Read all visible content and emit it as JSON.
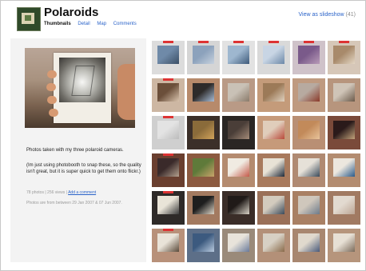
{
  "header": {
    "title": "Polaroids",
    "nav": [
      "Thumbnails",
      "Detail",
      "Map",
      "Comments"
    ],
    "nav_active": 0,
    "slideshow_label": "View as slideshow",
    "slideshow_count": "(41)"
  },
  "sidebar": {
    "description": "Photos taken with my three polaroid cameras.",
    "description2": "(Im just using photobooth to snap these, so the quality isn't great, but it is super quick to get them onto flickr.)",
    "meta_prefix": "78 photos | 256 views |",
    "comment_link": "Add a comment",
    "meta_dates": "Photos are from between 29 Jan 2007 & 07 Jun 2007."
  },
  "thumbnails": [
    {
      "bg": "#dcdcdc",
      "in": "#6f8aa8",
      "ac": "#3b4f66"
    },
    {
      "bg": "#d5d5d5",
      "in": "#8ca2bc",
      "ac": "#c7d2de"
    },
    {
      "bg": "#e2e2e2",
      "in": "#9eb7cf",
      "ac": "#3e5a7a"
    },
    {
      "bg": "#d9d9d9",
      "in": "#c8d5e4",
      "ac": "#6c88a8"
    },
    {
      "bg": "#cfc2c9",
      "in": "#7a5a8a",
      "ac": "#b89ab8"
    },
    {
      "bg": "#d6c7b8",
      "in": "#a88a6b",
      "ac": "#e3d6c4"
    },
    {
      "bg": "#cdb7a3",
      "in": "#6b4f3a",
      "ac": "#d8c3ad"
    },
    {
      "bg": "#b78a6b",
      "in": "#2e2b2a",
      "ac": "#a9bfd9"
    },
    {
      "bg": "#b99a86",
      "in": "#c9c1b6",
      "ac": "#8a7a6a"
    },
    {
      "bg": "#c49b7a",
      "in": "#9c7a58",
      "ac": "#e0d2c0"
    },
    {
      "bg": "#bf9a80",
      "in": "#b7aaa0",
      "ac": "#8a3a2a"
    },
    {
      "bg": "#b7957d",
      "in": "#cfc4b7",
      "ac": "#6b5a4a"
    },
    {
      "bg": "#cfcfcf",
      "in": "#e3e3e3",
      "ac": "#bcbcbc"
    },
    {
      "bg": "#3b2f29",
      "in": "#8a6b3a",
      "ac": "#d1a35a"
    },
    {
      "bg": "#2a2624",
      "in": "#4a3e38",
      "ac": "#a38a78"
    },
    {
      "bg": "#c69a7a",
      "in": "#e0cdbb",
      "ac": "#b94a3a"
    },
    {
      "bg": "#b98f74",
      "in": "#c28a5a",
      "ac": "#e8c39a"
    },
    {
      "bg": "#7a4a3a",
      "in": "#2a1a1a",
      "ac": "#c2a27a"
    },
    {
      "bg": "#6a3f2f",
      "in": "#3a2a2a",
      "ac": "#b3a08e"
    },
    {
      "bg": "#8c5a40",
      "in": "#5f7a3a",
      "ac": "#c9a46a"
    },
    {
      "bg": "#b48b6f",
      "in": "#f0ebe2",
      "ac": "#c45a4a"
    },
    {
      "bg": "#a87a5d",
      "in": "#e8e2d6",
      "ac": "#1f2a3a"
    },
    {
      "bg": "#b08a72",
      "in": "#e6e1d8",
      "ac": "#3a4a5a"
    },
    {
      "bg": "#b38c70",
      "in": "#ece7de",
      "ac": "#2a5a8a"
    },
    {
      "bg": "#2e2a28",
      "in": "#e9e4d8",
      "ac": "#3a3a3a"
    },
    {
      "bg": "#a37a60",
      "in": "#1e1e1e",
      "ac": "#e0d8ca"
    },
    {
      "bg": "#3a2d28",
      "in": "#201a18",
      "ac": "#d8d2c6"
    },
    {
      "bg": "#9a7058",
      "in": "#d3cbbe",
      "ac": "#3a4a5a"
    },
    {
      "bg": "#a98064",
      "in": "#cfc7bc",
      "ac": "#6c7a8a"
    },
    {
      "bg": "#a17a62",
      "in": "#e2dad0",
      "ac": "#bba594"
    },
    {
      "bg": "#b8917a",
      "in": "#e9e3d8",
      "ac": "#5a4a3a"
    },
    {
      "bg": "#5d6f88",
      "in": "#3c5a7f",
      "ac": "#b9cbe0"
    },
    {
      "bg": "#9a8a7a",
      "in": "#e8e3da",
      "ac": "#6a7a9a"
    },
    {
      "bg": "#b39078",
      "in": "#d7d0c4",
      "ac": "#8a6a4a"
    },
    {
      "bg": "#a88770",
      "in": "#e0d9cd",
      "ac": "#4a5a7a"
    },
    {
      "bg": "#b6957c",
      "in": "#e7e0d5",
      "ac": "#7a6a5a"
    }
  ]
}
